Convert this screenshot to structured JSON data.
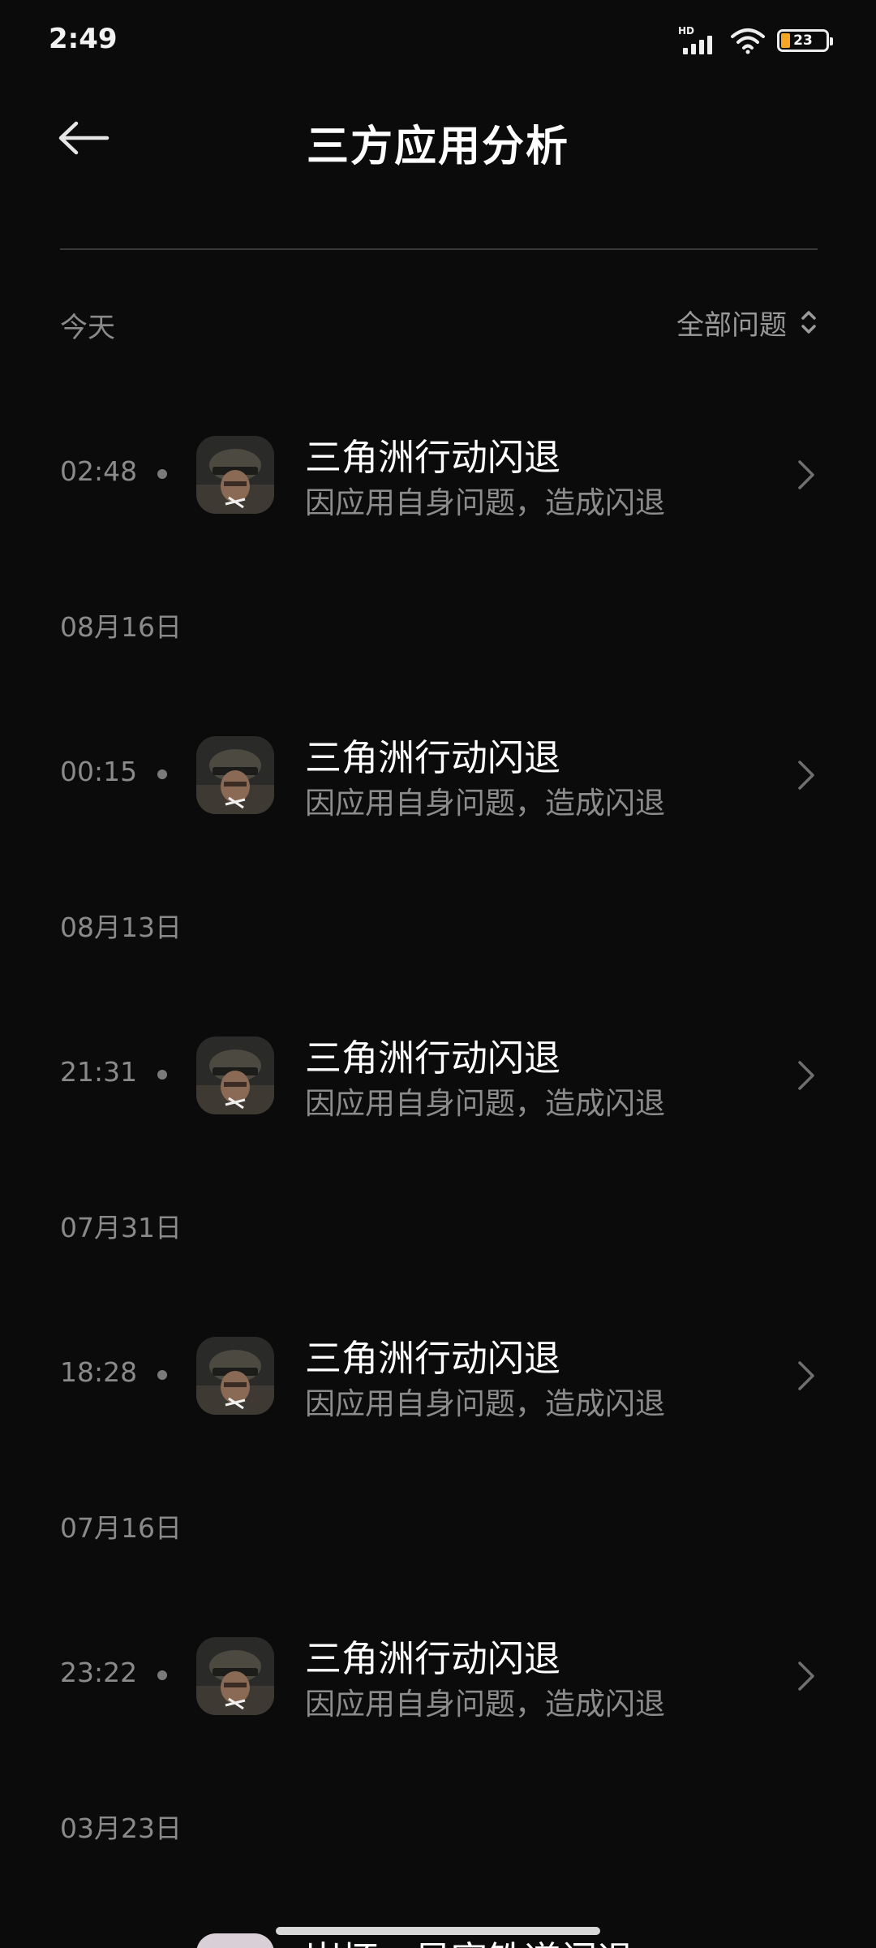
{
  "status_bar": {
    "time": "2:49",
    "network_badge": "HD",
    "battery_level": "23",
    "battery_color": "#f5a623"
  },
  "header": {
    "title": "三方应用分析",
    "back_icon": "arrow-left-icon"
  },
  "filter": {
    "today_label": "今天",
    "filter_label": "全部问题",
    "filter_icon": "sort-updown-icon"
  },
  "entries": [
    {
      "time": "02:48",
      "title": "三角洲行动闪退",
      "subtitle": "因应用自身问题，造成闪退"
    },
    {
      "time": "00:15",
      "title": "三角洲行动闪退",
      "subtitle": "因应用自身问题，造成闪退"
    },
    {
      "time": "21:31",
      "title": "三角洲行动闪退",
      "subtitle": "因应用自身问题，造成闪退"
    },
    {
      "time": "18:28",
      "title": "三角洲行动闪退",
      "subtitle": "因应用自身问题，造成闪退"
    },
    {
      "time": "23:22",
      "title": "三角洲行动闪退",
      "subtitle": "因应用自身问题，造成闪退"
    }
  ],
  "date_headers": [
    "08月16日",
    "08月13日",
    "07月31日",
    "07月16日",
    "03月23日"
  ],
  "partial_entry": {
    "title": "崩坏：星穹铁道闪退"
  }
}
